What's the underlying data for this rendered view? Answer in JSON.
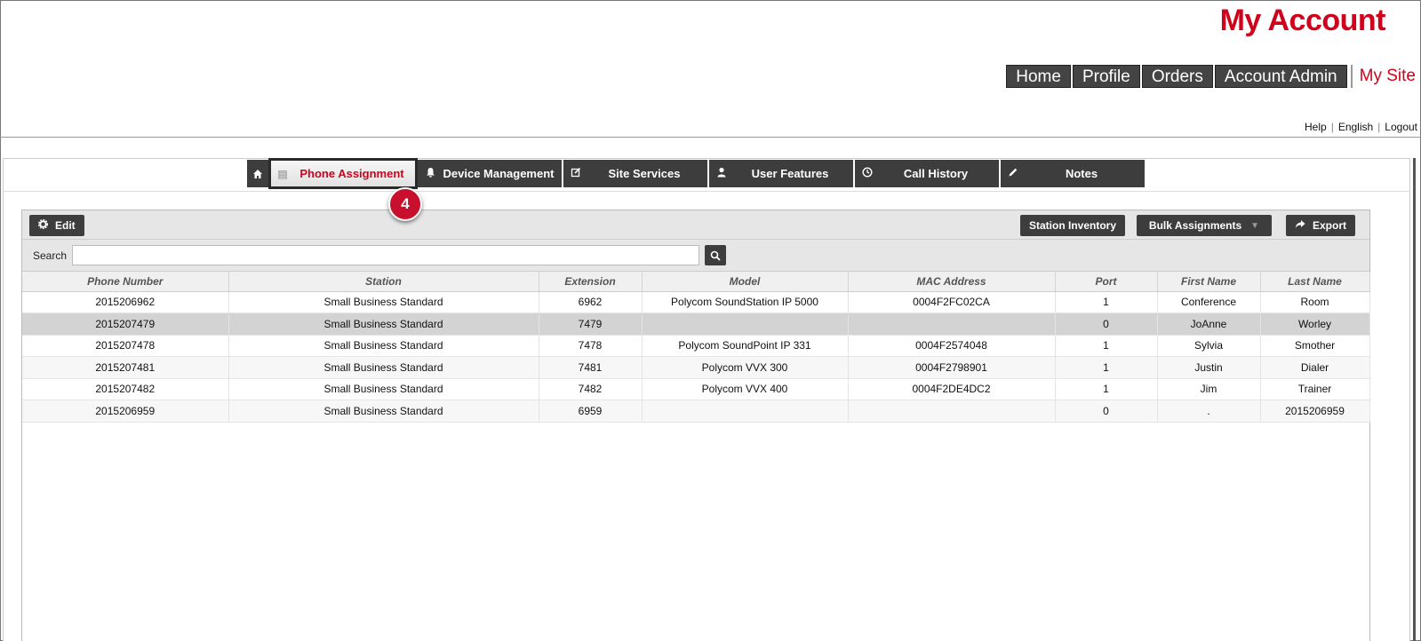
{
  "header": {
    "brand": "My Account",
    "nav": [
      "Home",
      "Profile",
      "Orders",
      "Account Admin"
    ],
    "nav_active": "My Site",
    "utility": [
      "Help",
      "English",
      "Logout"
    ]
  },
  "tabs": {
    "home_icon": "home-icon",
    "items": [
      {
        "label": "Phone Assignment",
        "icon": "list-icon",
        "glyph": "▤"
      },
      {
        "label": "Device Management",
        "icon": "bell-icon",
        "glyph": "🔔"
      },
      {
        "label": "Site Services",
        "icon": "edit-icon",
        "glyph": "✎"
      },
      {
        "label": "User Features",
        "icon": "user-icon",
        "glyph": "👤"
      },
      {
        "label": "Call History",
        "icon": "clock-icon",
        "glyph": "◷"
      },
      {
        "label": "Notes",
        "icon": "pencil-icon",
        "glyph": "✏"
      }
    ],
    "active_index": 0
  },
  "callout": {
    "number": "4"
  },
  "toolbar": {
    "edit_label": "Edit",
    "station_inventory_label": "Station Inventory",
    "bulk_assignments_label": "Bulk Assignments",
    "export_label": "Export"
  },
  "search": {
    "label": "Search",
    "placeholder": "",
    "value": ""
  },
  "table": {
    "columns": [
      "Phone Number",
      "Station",
      "Extension",
      "Model",
      "MAC Address",
      "Port",
      "First Name",
      "Last Name"
    ],
    "rows": [
      [
        "2015206962",
        "Small Business Standard",
        "6962",
        "Polycom SoundStation IP 5000",
        "0004F2FC02CA",
        "1",
        "Conference",
        "Room"
      ],
      [
        "2015207479",
        "Small Business Standard",
        "7479",
        "",
        "",
        "0",
        "JoAnne",
        "Worley"
      ],
      [
        "2015207478",
        "Small Business Standard",
        "7478",
        "Polycom SoundPoint IP 331",
        "0004F2574048",
        "1",
        "Sylvia",
        "Smother"
      ],
      [
        "2015207481",
        "Small Business Standard",
        "7481",
        "Polycom VVX 300",
        "0004F2798901",
        "1",
        "Justin",
        "Dialer"
      ],
      [
        "2015207482",
        "Small Business Standard",
        "7482",
        "Polycom VVX 400",
        "0004F2DE4DC2",
        "1",
        "Jim",
        "Trainer"
      ],
      [
        "2015206959",
        "Small Business Standard",
        "6959",
        "",
        "",
        "0",
        ".",
        "2015206959"
      ]
    ],
    "selected_row": 1
  },
  "colors": {
    "brand_red": "#d0021b",
    "dark": "#3d3d3d",
    "callout": "#c8102e"
  }
}
